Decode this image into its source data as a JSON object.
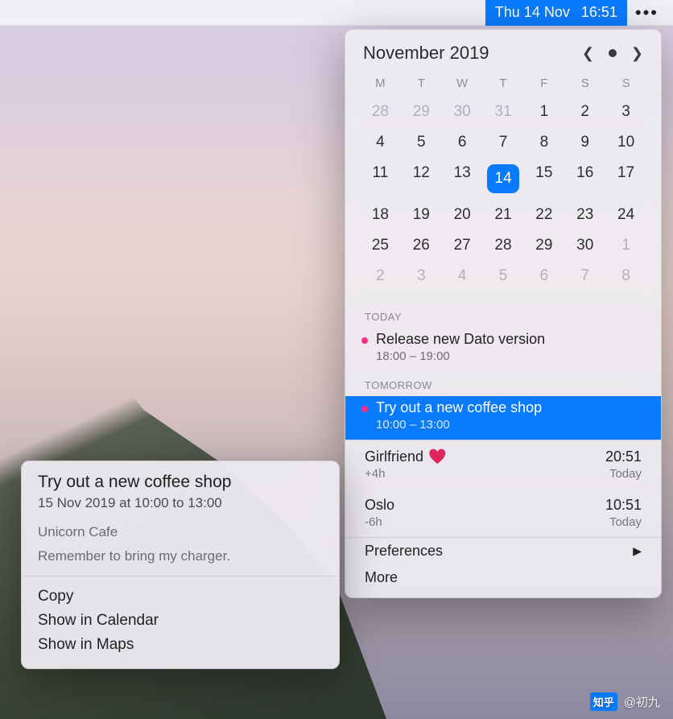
{
  "menubar": {
    "datetime_date": "Thu 14 Nov",
    "datetime_time": "16:51",
    "ellipsis": "•••"
  },
  "calendar": {
    "title": "November 2019",
    "weekdays": [
      "M",
      "T",
      "W",
      "T",
      "F",
      "S",
      "S"
    ],
    "weeks": [
      [
        {
          "d": "28",
          "dim": true
        },
        {
          "d": "29",
          "dim": true
        },
        {
          "d": "30",
          "dim": true
        },
        {
          "d": "31",
          "dim": true
        },
        {
          "d": "1"
        },
        {
          "d": "2"
        },
        {
          "d": "3"
        }
      ],
      [
        {
          "d": "4"
        },
        {
          "d": "5"
        },
        {
          "d": "6"
        },
        {
          "d": "7"
        },
        {
          "d": "8"
        },
        {
          "d": "9"
        },
        {
          "d": "10"
        }
      ],
      [
        {
          "d": "11"
        },
        {
          "d": "12"
        },
        {
          "d": "13"
        },
        {
          "d": "14",
          "sel": true
        },
        {
          "d": "15"
        },
        {
          "d": "16"
        },
        {
          "d": "17"
        }
      ],
      [
        {
          "d": "18"
        },
        {
          "d": "19"
        },
        {
          "d": "20"
        },
        {
          "d": "21"
        },
        {
          "d": "22"
        },
        {
          "d": "23"
        },
        {
          "d": "24"
        }
      ],
      [
        {
          "d": "25"
        },
        {
          "d": "26"
        },
        {
          "d": "27"
        },
        {
          "d": "28"
        },
        {
          "d": "29"
        },
        {
          "d": "30"
        },
        {
          "d": "1",
          "dim": true
        }
      ],
      [
        {
          "d": "2",
          "dim": true
        },
        {
          "d": "3",
          "dim": true
        },
        {
          "d": "4",
          "dim": true
        },
        {
          "d": "5",
          "dim": true
        },
        {
          "d": "6",
          "dim": true
        },
        {
          "d": "7",
          "dim": true
        },
        {
          "d": "8",
          "dim": true
        }
      ]
    ]
  },
  "sections": {
    "today_label": "TODAY",
    "today_event": {
      "title": "Release new Dato version",
      "time": "18:00 – 19:00"
    },
    "tomorrow_label": "TOMORROW",
    "tomorrow_event": {
      "title": "Try out a new coffee shop",
      "time": "10:00 – 13:00"
    }
  },
  "timezones": [
    {
      "name": "Girlfriend",
      "heart": "❤️",
      "offset": "+4h",
      "clock": "20:51",
      "day": "Today"
    },
    {
      "name": "Oslo",
      "heart": "",
      "offset": "-6h",
      "clock": "10:51",
      "day": "Today"
    }
  ],
  "menu": {
    "preferences": "Preferences",
    "more": "More"
  },
  "quicklook": {
    "title": "Try out a new coffee shop",
    "subtitle": "15 Nov 2019 at 10:00 to 13:00",
    "location": "Unicorn Cafe",
    "note": "Remember to bring my charger.",
    "actions": {
      "copy": "Copy",
      "show_cal": "Show in Calendar",
      "show_maps": "Show in Maps"
    }
  },
  "watermark": {
    "logo": "知乎",
    "handle": "@初九"
  }
}
